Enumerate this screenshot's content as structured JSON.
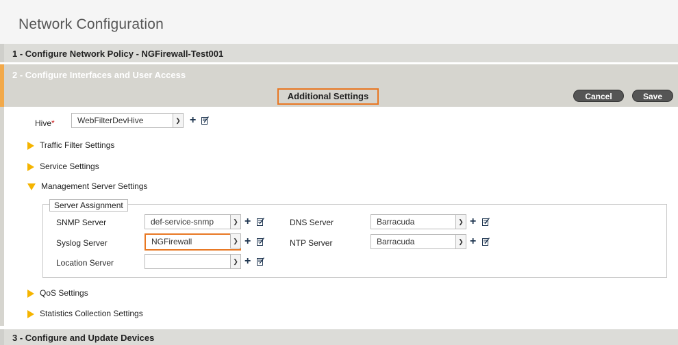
{
  "page": {
    "title": "Network Configuration"
  },
  "steps": {
    "step1": "1 - Configure Network Policy - NGFirewall-Test001",
    "step2": "2 - Configure Interfaces and User Access",
    "step3": "3 - Configure and Update Devices"
  },
  "toolbar": {
    "section_title": "Additional Settings",
    "cancel_label": "Cancel",
    "save_label": "Save"
  },
  "hive": {
    "label": "Hive",
    "required_mark": "*",
    "value": "WebFilterDevHive"
  },
  "sections": {
    "traffic_filter": "Traffic Filter Settings",
    "service": "Service Settings",
    "management_server": "Management Server Settings",
    "qos": "QoS Settings",
    "statistics": "Statistics Collection Settings"
  },
  "server_assignment": {
    "legend": "Server Assignment",
    "snmp": {
      "label": "SNMP Server",
      "value": "def-service-snmp"
    },
    "syslog": {
      "label": "Syslog Server",
      "value": "NGFirewall"
    },
    "location": {
      "label": "Location Server",
      "value": ""
    },
    "dns": {
      "label": "DNS Server",
      "value": "Barracuda"
    },
    "ntp": {
      "label": "NTP Server",
      "value": "Barracuda"
    }
  },
  "colors": {
    "accent_orange": "#e87722",
    "expander_yellow": "#f5b400",
    "step_active": "#f2a94a"
  },
  "icons": {
    "add": "plus-icon",
    "edit": "edit-icon",
    "dropdown": "chevron-down-icon",
    "expand": "triangle-right-icon",
    "collapse": "triangle-down-icon"
  }
}
